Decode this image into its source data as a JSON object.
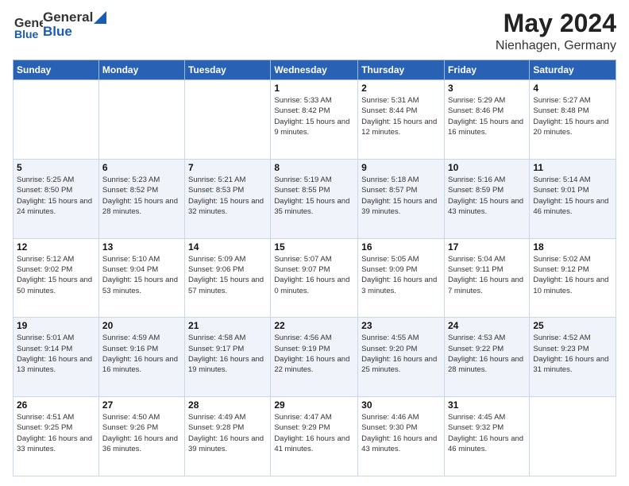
{
  "header": {
    "logo_general": "General",
    "logo_blue": "Blue",
    "month_year": "May 2024",
    "location": "Nienhagen, Germany"
  },
  "weekdays": [
    "Sunday",
    "Monday",
    "Tuesday",
    "Wednesday",
    "Thursday",
    "Friday",
    "Saturday"
  ],
  "weeks": [
    [
      {
        "day": "",
        "sunrise": "",
        "sunset": "",
        "daylight": ""
      },
      {
        "day": "",
        "sunrise": "",
        "sunset": "",
        "daylight": ""
      },
      {
        "day": "",
        "sunrise": "",
        "sunset": "",
        "daylight": ""
      },
      {
        "day": "1",
        "sunrise": "Sunrise: 5:33 AM",
        "sunset": "Sunset: 8:42 PM",
        "daylight": "Daylight: 15 hours and 9 minutes."
      },
      {
        "day": "2",
        "sunrise": "Sunrise: 5:31 AM",
        "sunset": "Sunset: 8:44 PM",
        "daylight": "Daylight: 15 hours and 12 minutes."
      },
      {
        "day": "3",
        "sunrise": "Sunrise: 5:29 AM",
        "sunset": "Sunset: 8:46 PM",
        "daylight": "Daylight: 15 hours and 16 minutes."
      },
      {
        "day": "4",
        "sunrise": "Sunrise: 5:27 AM",
        "sunset": "Sunset: 8:48 PM",
        "daylight": "Daylight: 15 hours and 20 minutes."
      }
    ],
    [
      {
        "day": "5",
        "sunrise": "Sunrise: 5:25 AM",
        "sunset": "Sunset: 8:50 PM",
        "daylight": "Daylight: 15 hours and 24 minutes."
      },
      {
        "day": "6",
        "sunrise": "Sunrise: 5:23 AM",
        "sunset": "Sunset: 8:52 PM",
        "daylight": "Daylight: 15 hours and 28 minutes."
      },
      {
        "day": "7",
        "sunrise": "Sunrise: 5:21 AM",
        "sunset": "Sunset: 8:53 PM",
        "daylight": "Daylight: 15 hours and 32 minutes."
      },
      {
        "day": "8",
        "sunrise": "Sunrise: 5:19 AM",
        "sunset": "Sunset: 8:55 PM",
        "daylight": "Daylight: 15 hours and 35 minutes."
      },
      {
        "day": "9",
        "sunrise": "Sunrise: 5:18 AM",
        "sunset": "Sunset: 8:57 PM",
        "daylight": "Daylight: 15 hours and 39 minutes."
      },
      {
        "day": "10",
        "sunrise": "Sunrise: 5:16 AM",
        "sunset": "Sunset: 8:59 PM",
        "daylight": "Daylight: 15 hours and 43 minutes."
      },
      {
        "day": "11",
        "sunrise": "Sunrise: 5:14 AM",
        "sunset": "Sunset: 9:01 PM",
        "daylight": "Daylight: 15 hours and 46 minutes."
      }
    ],
    [
      {
        "day": "12",
        "sunrise": "Sunrise: 5:12 AM",
        "sunset": "Sunset: 9:02 PM",
        "daylight": "Daylight: 15 hours and 50 minutes."
      },
      {
        "day": "13",
        "sunrise": "Sunrise: 5:10 AM",
        "sunset": "Sunset: 9:04 PM",
        "daylight": "Daylight: 15 hours and 53 minutes."
      },
      {
        "day": "14",
        "sunrise": "Sunrise: 5:09 AM",
        "sunset": "Sunset: 9:06 PM",
        "daylight": "Daylight: 15 hours and 57 minutes."
      },
      {
        "day": "15",
        "sunrise": "Sunrise: 5:07 AM",
        "sunset": "Sunset: 9:07 PM",
        "daylight": "Daylight: 16 hours and 0 minutes."
      },
      {
        "day": "16",
        "sunrise": "Sunrise: 5:05 AM",
        "sunset": "Sunset: 9:09 PM",
        "daylight": "Daylight: 16 hours and 3 minutes."
      },
      {
        "day": "17",
        "sunrise": "Sunrise: 5:04 AM",
        "sunset": "Sunset: 9:11 PM",
        "daylight": "Daylight: 16 hours and 7 minutes."
      },
      {
        "day": "18",
        "sunrise": "Sunrise: 5:02 AM",
        "sunset": "Sunset: 9:12 PM",
        "daylight": "Daylight: 16 hours and 10 minutes."
      }
    ],
    [
      {
        "day": "19",
        "sunrise": "Sunrise: 5:01 AM",
        "sunset": "Sunset: 9:14 PM",
        "daylight": "Daylight: 16 hours and 13 minutes."
      },
      {
        "day": "20",
        "sunrise": "Sunrise: 4:59 AM",
        "sunset": "Sunset: 9:16 PM",
        "daylight": "Daylight: 16 hours and 16 minutes."
      },
      {
        "day": "21",
        "sunrise": "Sunrise: 4:58 AM",
        "sunset": "Sunset: 9:17 PM",
        "daylight": "Daylight: 16 hours and 19 minutes."
      },
      {
        "day": "22",
        "sunrise": "Sunrise: 4:56 AM",
        "sunset": "Sunset: 9:19 PM",
        "daylight": "Daylight: 16 hours and 22 minutes."
      },
      {
        "day": "23",
        "sunrise": "Sunrise: 4:55 AM",
        "sunset": "Sunset: 9:20 PM",
        "daylight": "Daylight: 16 hours and 25 minutes."
      },
      {
        "day": "24",
        "sunrise": "Sunrise: 4:53 AM",
        "sunset": "Sunset: 9:22 PM",
        "daylight": "Daylight: 16 hours and 28 minutes."
      },
      {
        "day": "25",
        "sunrise": "Sunrise: 4:52 AM",
        "sunset": "Sunset: 9:23 PM",
        "daylight": "Daylight: 16 hours and 31 minutes."
      }
    ],
    [
      {
        "day": "26",
        "sunrise": "Sunrise: 4:51 AM",
        "sunset": "Sunset: 9:25 PM",
        "daylight": "Daylight: 16 hours and 33 minutes."
      },
      {
        "day": "27",
        "sunrise": "Sunrise: 4:50 AM",
        "sunset": "Sunset: 9:26 PM",
        "daylight": "Daylight: 16 hours and 36 minutes."
      },
      {
        "day": "28",
        "sunrise": "Sunrise: 4:49 AM",
        "sunset": "Sunset: 9:28 PM",
        "daylight": "Daylight: 16 hours and 39 minutes."
      },
      {
        "day": "29",
        "sunrise": "Sunrise: 4:47 AM",
        "sunset": "Sunset: 9:29 PM",
        "daylight": "Daylight: 16 hours and 41 minutes."
      },
      {
        "day": "30",
        "sunrise": "Sunrise: 4:46 AM",
        "sunset": "Sunset: 9:30 PM",
        "daylight": "Daylight: 16 hours and 43 minutes."
      },
      {
        "day": "31",
        "sunrise": "Sunrise: 4:45 AM",
        "sunset": "Sunset: 9:32 PM",
        "daylight": "Daylight: 16 hours and 46 minutes."
      },
      {
        "day": "",
        "sunrise": "",
        "sunset": "",
        "daylight": ""
      }
    ]
  ]
}
